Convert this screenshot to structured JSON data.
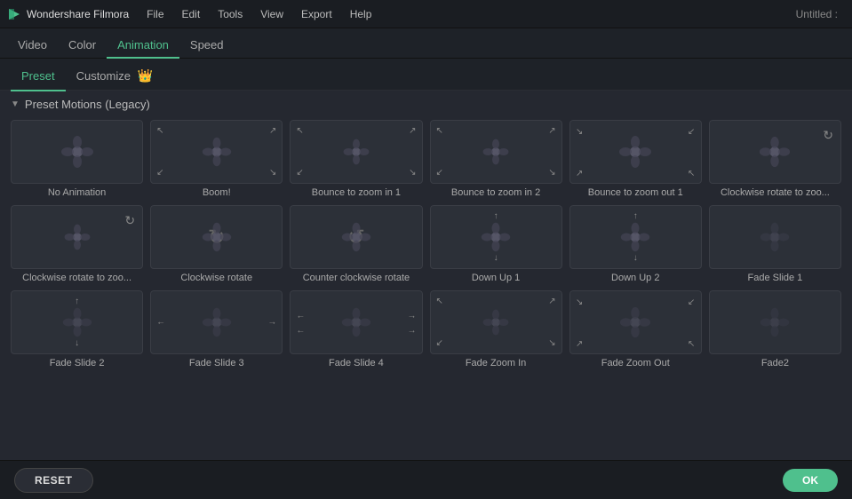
{
  "titleBar": {
    "appName": "Wondershare Filmora",
    "menus": [
      "File",
      "Edit",
      "Tools",
      "View",
      "Export",
      "Help"
    ],
    "windowTitle": "Untitled :"
  },
  "tabs": {
    "items": [
      "Video",
      "Color",
      "Animation",
      "Speed"
    ],
    "active": "Animation"
  },
  "subTabs": {
    "items": [
      "Preset",
      "Customize"
    ],
    "active": "Preset",
    "crownIcon": "👑"
  },
  "sectionHeader": "Preset Motions (Legacy)",
  "animations": [
    {
      "id": "no-animation",
      "label": "No Animation",
      "arrows": [],
      "rotateTop": false,
      "rotateCenter": false
    },
    {
      "id": "boom",
      "label": "Boom!",
      "arrows": [
        "tl",
        "tr",
        "bl",
        "br"
      ],
      "rotateTop": false,
      "rotateCenter": false
    },
    {
      "id": "bounce-zoom-in-1",
      "label": "Bounce to zoom in 1",
      "arrows": [
        "tl",
        "tr",
        "bl",
        "br"
      ],
      "rotateTop": false,
      "rotateCenter": false
    },
    {
      "id": "bounce-zoom-in-2",
      "label": "Bounce to zoom in 2",
      "arrows": [
        "tl",
        "tr",
        "bl",
        "br"
      ],
      "rotateTop": false,
      "rotateCenter": false
    },
    {
      "id": "bounce-zoom-out-1",
      "label": "Bounce to zoom out 1",
      "arrows": [
        "tl-out",
        "tr-out",
        "bl-out",
        "br-out"
      ],
      "rotateTop": false,
      "rotateCenter": false
    },
    {
      "id": "clockwise-rotate-zoo",
      "label": "Clockwise rotate to zoo...",
      "arrows": [],
      "rotateTop": true,
      "rotateCenter": false
    },
    {
      "id": "clockwise-rotate-zoo2",
      "label": "Clockwise rotate to zoo...",
      "arrows": [],
      "rotateTop": true,
      "rotateCenter": false
    },
    {
      "id": "clockwise-rotate",
      "label": "Clockwise rotate",
      "arrows": [],
      "rotateTop": false,
      "rotateCenter": true
    },
    {
      "id": "counter-clockwise-rotate",
      "label": "Counter clockwise rotate",
      "arrows": [],
      "rotateTop": false,
      "rotateCenter": true,
      "ccw": true
    },
    {
      "id": "down-up-1",
      "label": "Down Up 1",
      "arrows": [
        "t",
        "b"
      ],
      "rotateTop": false,
      "rotateCenter": false
    },
    {
      "id": "down-up-2",
      "label": "Down Up 2",
      "arrows": [
        "t",
        "b"
      ],
      "rotateTop": false,
      "rotateCenter": false
    },
    {
      "id": "fade-slide-1",
      "label": "Fade Slide 1",
      "arrows": [],
      "rotateTop": false,
      "rotateCenter": false
    },
    {
      "id": "fade-slide-2",
      "label": "Fade Slide 2",
      "arrows": [
        "t",
        "b"
      ],
      "rotateTop": false,
      "rotateCenter": false
    },
    {
      "id": "fade-slide-3",
      "label": "Fade Slide 3",
      "arrows": [
        "l",
        "r"
      ],
      "rotateTop": false,
      "rotateCenter": false
    },
    {
      "id": "fade-slide-4",
      "label": "Fade Slide 4",
      "arrows": [
        "l",
        "r"
      ],
      "rotateTop": false,
      "rotateCenter": false
    },
    {
      "id": "fade-zoom-in",
      "label": "Fade Zoom In",
      "arrows": [
        "tl",
        "tr",
        "bl",
        "br"
      ],
      "rotateTop": false,
      "rotateCenter": false
    },
    {
      "id": "fade-zoom-out",
      "label": "Fade Zoom Out",
      "arrows": [
        "tl-out",
        "tr-out",
        "bl-out",
        "br-out"
      ],
      "rotateTop": false,
      "rotateCenter": false
    },
    {
      "id": "fade2",
      "label": "Fade2",
      "arrows": [],
      "rotateTop": false,
      "rotateCenter": false
    }
  ],
  "buttons": {
    "reset": "RESET",
    "ok": "OK"
  }
}
